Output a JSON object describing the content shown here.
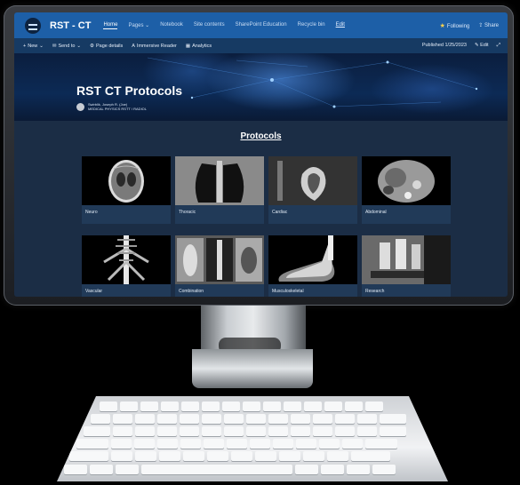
{
  "site": {
    "title": "RST - CT",
    "nav": [
      {
        "label": "Home",
        "active": true
      },
      {
        "label": "Pages",
        "active": false
      },
      {
        "label": "Notebook",
        "active": false
      },
      {
        "label": "Site contents",
        "active": false
      },
      {
        "label": "SharePoint Education",
        "active": false
      },
      {
        "label": "Recycle bin",
        "active": false
      },
      {
        "label": "Edit",
        "active": false
      }
    ],
    "following": "Following",
    "share": "Share"
  },
  "command_bar": {
    "new": "New",
    "send_to": "Send to",
    "page_details": "Page details",
    "immersive_reader": "Immersive Reader",
    "analytics": "Analytics",
    "published": "Published 1/25/2023",
    "edit": "Edit"
  },
  "hero": {
    "title": "RST CT Protocols",
    "author_name": "Swirblik, Joseph R. (Joe)",
    "author_role": "MEDICAL PHYSICS RSTT / RADIOL"
  },
  "main": {
    "section_title": "Protocols",
    "cards": [
      {
        "label": "Neuro",
        "icon": "brain-ct-image"
      },
      {
        "label": "Thoracic",
        "icon": "lung-ct-image"
      },
      {
        "label": "Cardiac",
        "icon": "heart-ct-image"
      },
      {
        "label": "Abdominal",
        "icon": "abdomen-ct-image"
      },
      {
        "label": "Vascular",
        "icon": "vascular-ct-image"
      },
      {
        "label": "Combination",
        "icon": "combination-ct-image"
      },
      {
        "label": "Musculoskeletal",
        "icon": "foot-ct-image"
      },
      {
        "label": "Research",
        "icon": "microscope-image"
      }
    ]
  },
  "colors": {
    "suite_bar": "#1d5fa7",
    "command_bar": "#163a63",
    "page_bg": "#1b2d45",
    "card_bg": "#213a58"
  }
}
